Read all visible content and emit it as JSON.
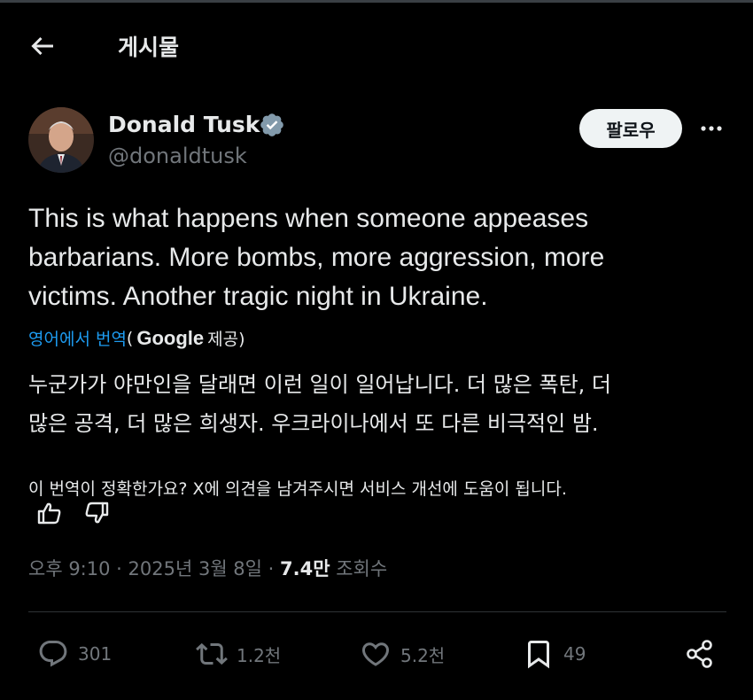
{
  "header": {
    "title": "게시물"
  },
  "author": {
    "name": "Donald Tusk",
    "handle": "@donaldtusk"
  },
  "follow_label": "팔로우",
  "tweet": {
    "lines": [
      "This is what happens when someone appeases",
      "barbarians. More bombs, more aggression, more",
      "victims. Another tragic night in Ukraine."
    ]
  },
  "translation": {
    "link_text": "영어에서 번역",
    "paren_open": "(",
    "provider": "Google",
    "provider_suffix": "제공)",
    "lines": [
      "누군가가 야만인을 달래면 이런 일이 일어납니다. 더 많은 폭탄, 더",
      "많은 공격, 더 많은 희생자. 우크라이나에서 또 다른 비극적인 밤."
    ],
    "feedback_question": "이 번역이 정확한가요? X에 의견을 남겨주시면 서비스 개선에 도움이 됩니다."
  },
  "meta": {
    "time": "오후 9:10",
    "sep1": " · ",
    "date": "2025년 3월 8일",
    "sep2": " · ",
    "views_count": "7.4만",
    "views_label": " 조회수"
  },
  "actions": {
    "replies": "301",
    "reposts": "1.2천",
    "likes": "5.2천",
    "bookmarks": "49"
  },
  "colors": {
    "background": "#000000",
    "text": "#e7e9ea",
    "muted": "#71767b",
    "accent": "#1d9bf0",
    "follow_bg": "#eff3f4"
  },
  "icons": [
    "back-arrow-icon",
    "verified-badge-icon",
    "more-icon",
    "thumbs-up-icon",
    "thumbs-down-icon",
    "reply-icon",
    "repost-icon",
    "like-icon",
    "bookmark-icon",
    "share-icon"
  ]
}
